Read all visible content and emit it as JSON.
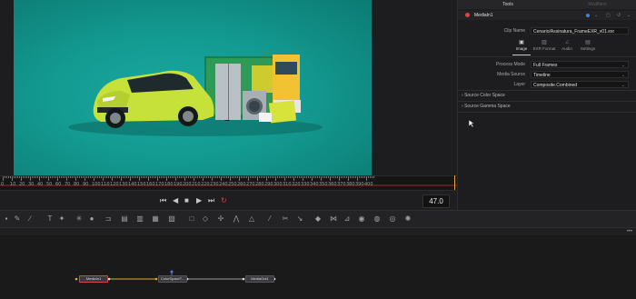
{
  "inspector": {
    "tab_tools": "Tools",
    "tab_modifiers": "Modifiers",
    "node_name": "MediaIn1",
    "clip_name_label": "Clip Name",
    "clip_name_value": "Cenario/Assinatura_FrameEXR_v01.exr",
    "subtabs": [
      "Image",
      "EXR Format",
      "Audio",
      "Settings"
    ],
    "process_mode_label": "Process Mode",
    "process_mode_value": "Full Frames",
    "media_source_label": "Media Source",
    "media_source_value": "Timeline",
    "layer_label": "Layer",
    "layer_value": "Composite.Combined",
    "section_color_space": "Source Color Space",
    "section_gamma_space": "Source Gamma Space"
  },
  "ruler": {
    "labels": [
      "0",
      "10",
      "20",
      "30",
      "40",
      "50",
      "60",
      "70",
      "80",
      "90",
      "100",
      "110",
      "120",
      "130",
      "140",
      "150",
      "160",
      "170",
      "180",
      "190",
      "200",
      "210",
      "220",
      "230",
      "240",
      "250",
      "260",
      "270",
      "280",
      "290",
      "300",
      "310",
      "320",
      "330",
      "340",
      "350",
      "360",
      "370",
      "380",
      "390",
      "400"
    ]
  },
  "transport": {
    "frame_number": "47.0"
  },
  "nodes": {
    "n1": "MediaIn1",
    "n2": "ColorSpaceT...",
    "n3": "MediaOut1"
  },
  "colors": {
    "accent": "#e8a83a",
    "loop_red": "#e04545",
    "teal_bg": "#139a91",
    "car_green": "#c6e13a"
  }
}
